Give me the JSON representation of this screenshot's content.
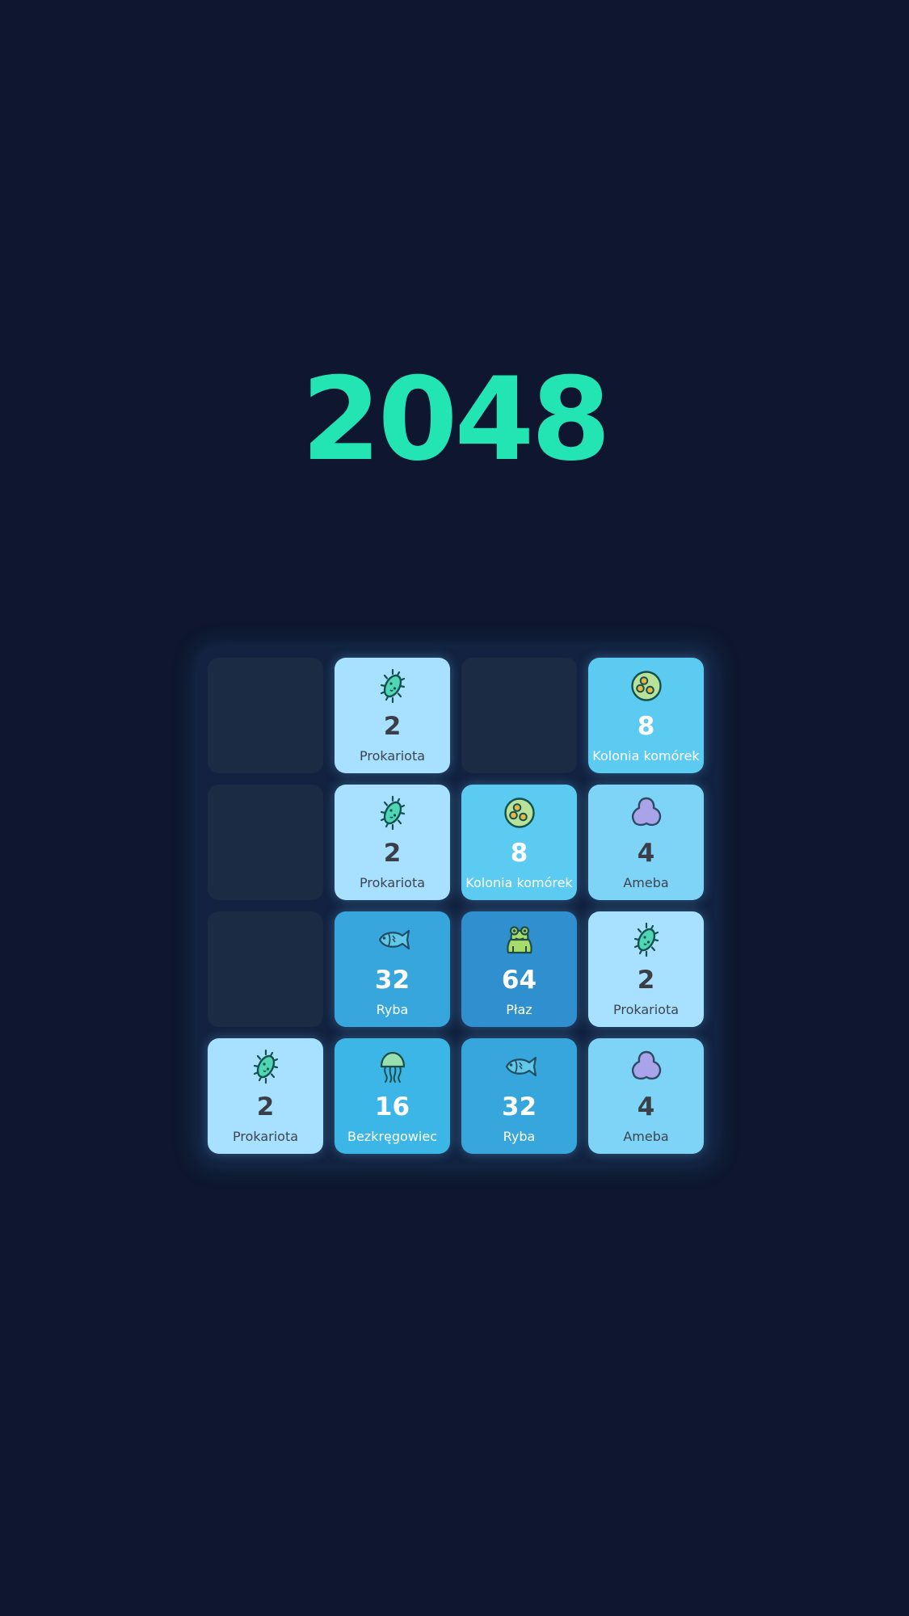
{
  "title": "2048",
  "grid": {
    "size": 4,
    "tiles": [
      {
        "row": 0,
        "col": 1,
        "value": "2",
        "name": "Prokariota",
        "icon": "bacteria-icon"
      },
      {
        "row": 0,
        "col": 3,
        "value": "8",
        "name": "Kolonia komórek",
        "icon": "cell-colony-icon"
      },
      {
        "row": 1,
        "col": 1,
        "value": "2",
        "name": "Prokariota",
        "icon": "bacteria-icon"
      },
      {
        "row": 1,
        "col": 2,
        "value": "8",
        "name": "Kolonia komórek",
        "icon": "cell-colony-icon"
      },
      {
        "row": 1,
        "col": 3,
        "value": "4",
        "name": "Ameba",
        "icon": "amoeba-icon"
      },
      {
        "row": 2,
        "col": 1,
        "value": "32",
        "name": "Ryba",
        "icon": "fish-icon"
      },
      {
        "row": 2,
        "col": 2,
        "value": "64",
        "name": "Płaz",
        "icon": "frog-icon"
      },
      {
        "row": 2,
        "col": 3,
        "value": "2",
        "name": "Prokariota",
        "icon": "bacteria-icon"
      },
      {
        "row": 3,
        "col": 0,
        "value": "2",
        "name": "Prokariota",
        "icon": "bacteria-icon"
      },
      {
        "row": 3,
        "col": 1,
        "value": "16",
        "name": "Bezkręgowiec",
        "icon": "jellyfish-icon"
      },
      {
        "row": 3,
        "col": 2,
        "value": "32",
        "name": "Ryba",
        "icon": "fish-icon"
      },
      {
        "row": 3,
        "col": 3,
        "value": "4",
        "name": "Ameba",
        "icon": "amoeba-icon"
      }
    ]
  },
  "colors": {
    "background": "#0e172f",
    "title": "#22e5b3",
    "board": "#122240",
    "empty_cell": "#1c2b44"
  }
}
